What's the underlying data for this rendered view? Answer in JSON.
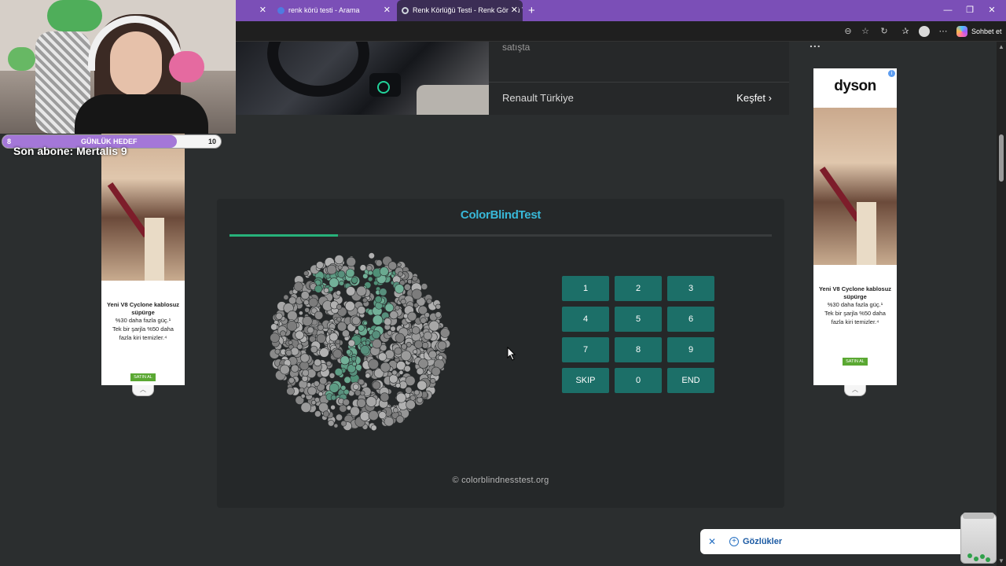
{
  "browser": {
    "tabs": [
      {
        "title": ""
      },
      {
        "title": "renk körü testi - Arama"
      },
      {
        "title": "Renk Körlüğü Testi - Renk Görüşü Testi"
      }
    ],
    "new_tab_label": "+",
    "sohbet_label": "Sohbet et"
  },
  "top_ad": {
    "subtitle": "satışta",
    "brand": "Renault Türkiye",
    "cta": "Keşfet",
    "right_fragment": "..."
  },
  "stream": {
    "goal_left": "8",
    "goal_label": "GÜNLÜK HEDEF",
    "goal_right": "10",
    "goal_progress": 0.8,
    "last_sub": "Son abone: Mertalis  9"
  },
  "side_ads": [
    {
      "brand": "dyson",
      "line1": "Yeni V8 Cyclone kablosuz süpürge",
      "line2": "%30 daha fazla güç.¹",
      "line3": "Tek bir şarjla %50 daha",
      "line4": "fazla kiri temizler.⁴",
      "button": "SATIN AL"
    },
    {
      "brand": "dyson",
      "line1": "Yeni V8 Cyclone kablosuz süpürge",
      "line2": "%30 daha fazla güç.¹",
      "line3": "Tek bir şarjla %50 daha",
      "line4": "fazla kiri temizler.⁴",
      "button": "SATIN AL"
    }
  ],
  "test": {
    "title": "ColorBlindTest",
    "progress": 0.2,
    "plate_number": "7",
    "keys": [
      "1",
      "2",
      "3",
      "4",
      "5",
      "6",
      "7",
      "8",
      "9",
      "SKIP",
      "0",
      "END"
    ],
    "copyright": "© colorblindnesstest.org"
  },
  "chip": {
    "close": "✕",
    "label": "Gözlükler"
  },
  "colors": {
    "tab_bar": "#7b4fb7",
    "title": "#38b8d8",
    "progress": "#27b27a",
    "key": "#1c6f68"
  }
}
